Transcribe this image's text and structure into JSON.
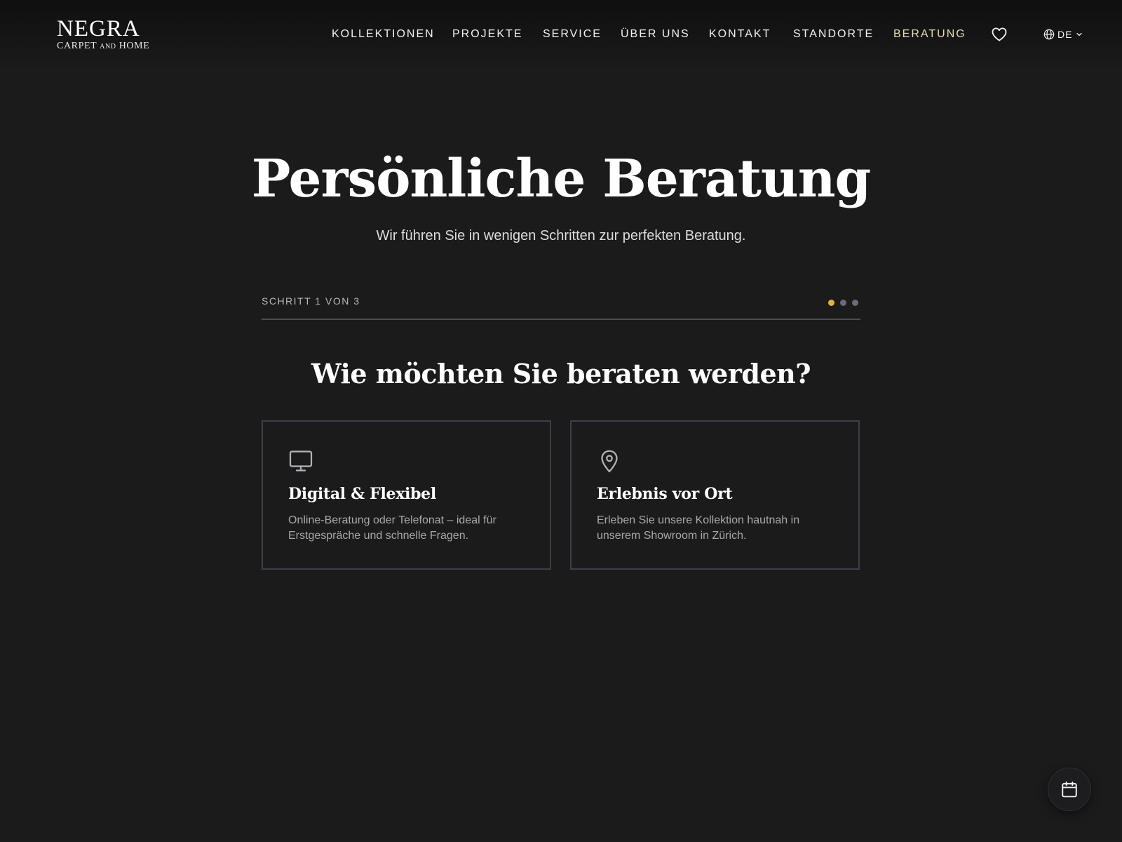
{
  "header": {
    "logo": {
      "name": "NEGRA",
      "sub_pre": "CARPET",
      "sub_and": "AND",
      "sub_post": "HOME"
    },
    "nav": [
      {
        "label": "KOLLEKTIONEN"
      },
      {
        "label": "PROJEKTE"
      },
      {
        "label": "SERVICE"
      },
      {
        "label": "ÜBER UNS"
      },
      {
        "label": "KONTAKT"
      },
      {
        "label": "STANDORTE"
      },
      {
        "label": "BERATUNG",
        "active": true
      }
    ],
    "favorites_icon": "heart-icon",
    "language": {
      "icon": "globe-icon",
      "value": "DE",
      "dropdown_icon": "chevron-down-icon"
    }
  },
  "hero": {
    "title": "Persönliche Beratung",
    "subtitle": "Wir führen Sie in wenigen Schritten zur perfekten Beratung."
  },
  "progress": {
    "label": "SCHRITT 1 VON 3",
    "current_step": 1,
    "total_steps": 3,
    "active_color": "#e0b43c",
    "inactive_color": "#6a6d78"
  },
  "question": "Wie möchten Sie beraten werden?",
  "options": [
    {
      "icon": "monitor-icon",
      "title": "Digital & Flexibel",
      "description": "Online-Beratung oder Telefonat – ideal für Erstgespräche und schnelle Fragen."
    },
    {
      "icon": "map-pin-icon",
      "title": "Erlebnis vor Ort",
      "description": "Erleben Sie unsere Kollektion hautnah in unserem Showroom in Zürich."
    }
  ],
  "fab": {
    "icon": "calendar-icon"
  },
  "colors": {
    "background": "#1b1b1c",
    "accent": "#e9ddb0",
    "card_border": "#3c3f49"
  }
}
